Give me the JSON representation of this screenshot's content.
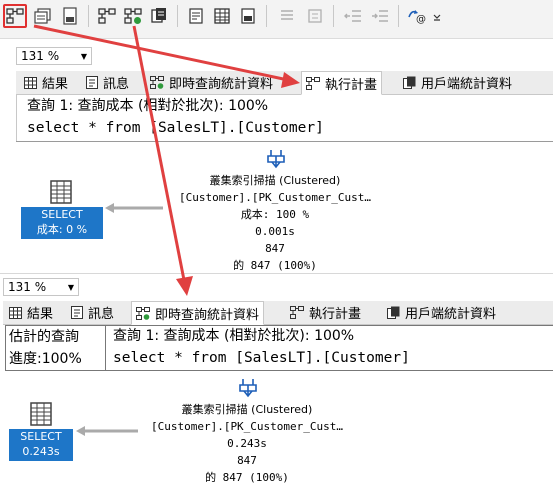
{
  "zoom": {
    "top": "131 %",
    "bottom": "131 %"
  },
  "tabs": {
    "results": "結果",
    "messages": "訊息",
    "live_query_stats": "即時查詢統計資料",
    "execution_plan": "執行計畫",
    "client_stats": "用戶端統計資料"
  },
  "plan_top": {
    "query_header": "查詢 1: 查詢成本 (相對於批次): 100%",
    "query_sql": "select * from [SalesLT].[Customer]",
    "select_label": "SELECT",
    "select_cost": "成本: 0 %",
    "op_name": "叢集索引掃描 (Clustered)",
    "op_object": "[Customer].[PK_Customer_Cust…",
    "op_cost": "成本: 100 %",
    "op_time": "0.001s",
    "op_rows": "847",
    "op_of_rows": "的 847 (100%)"
  },
  "plan_bottom": {
    "progress_label_1": "估計的查詢",
    "progress_label_2": "進度:100%",
    "query_header": "查詢 1: 查詢成本 (相對於批次): 100%",
    "query_sql": "select * from [SalesLT].[Customer]",
    "select_label": "SELECT",
    "select_time": "0.243s",
    "op_name": "叢集索引掃描 (Clustered)",
    "op_object": "[Customer].[PK_Customer_Cust…",
    "op_time": "0.243s",
    "op_rows": "847",
    "op_of_rows": "的 847 (100%)"
  },
  "toolbar": {
    "icons": [
      "display-estimated-plan-icon",
      "query-options-icon",
      "intellisense-icon",
      "actual-plan-icon",
      "live-stats-icon",
      "client-stats-icon",
      "results-text-icon",
      "results-grid-icon",
      "results-file-icon",
      "comment-icon",
      "uncomment-icon",
      "decrease-indent-icon",
      "increase-indent-icon",
      "specify-values-icon",
      "overflow-icon"
    ]
  },
  "colors": {
    "select_box": "#1e76c8",
    "highlight": "#e03030",
    "arrow": "#e04040"
  }
}
